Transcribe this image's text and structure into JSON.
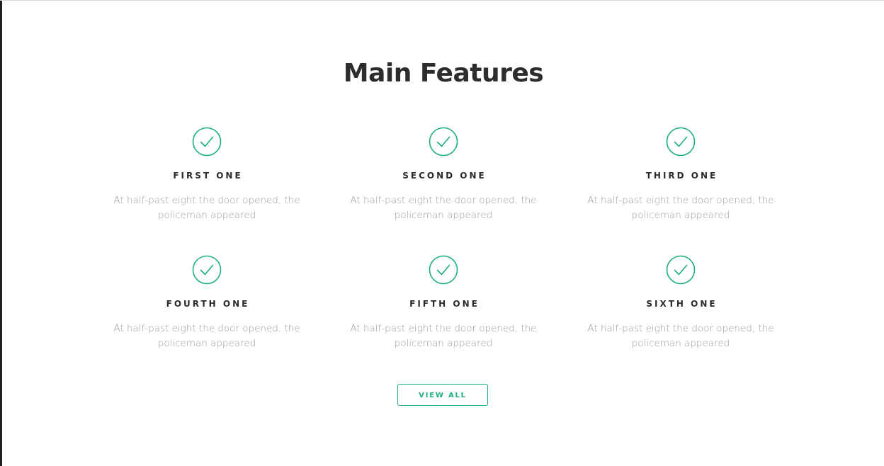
{
  "section": {
    "title": "Main Features"
  },
  "features": [
    {
      "title": "FIRST ONE",
      "description": "At half-past eight the door opened, the policeman appeared",
      "icon": "check-circle-icon"
    },
    {
      "title": "SECOND ONE",
      "description": "At half-past eight the door opened, the policeman appeared",
      "icon": "check-circle-icon"
    },
    {
      "title": "THIRD ONE",
      "description": "At half-past eight the door opened, the policeman appeared",
      "icon": "check-circle-icon"
    },
    {
      "title": "FOURTH ONE",
      "description": "At half-past eight the door opened, the policeman appeared",
      "icon": "check-circle-icon"
    },
    {
      "title": "FIFTH ONE",
      "description": "At half-past eight the door opened, the policeman appeared",
      "icon": "check-circle-icon"
    },
    {
      "title": "SIXTH ONE",
      "description": "At half-past eight the door opened, the policeman appeared",
      "icon": "check-circle-icon"
    }
  ],
  "cta": {
    "label": "VIEW ALL"
  },
  "colors": {
    "accent": "#1dae80",
    "title": "#2d2d2d",
    "feature_title": "#2a2a2a",
    "description": "#9b9b9b",
    "background": "#ffffff"
  }
}
